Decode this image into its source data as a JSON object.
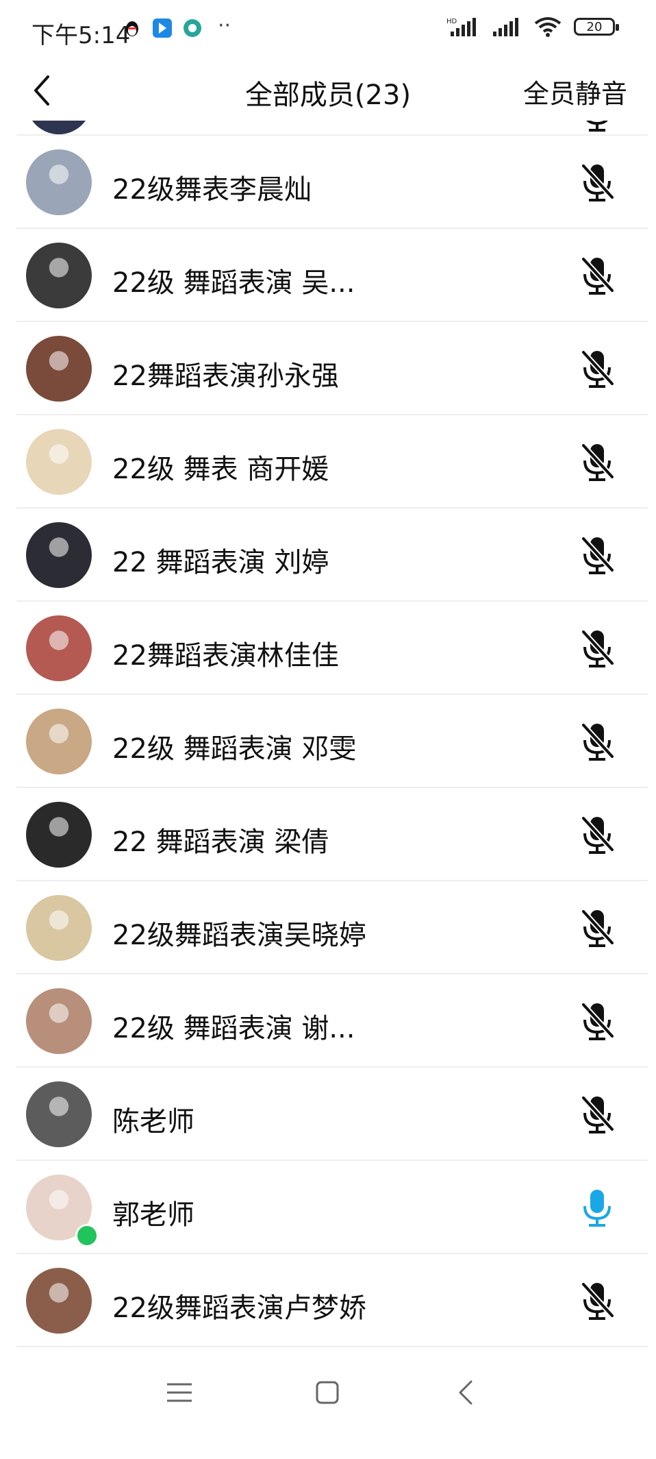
{
  "status": {
    "time": "下午5:14",
    "battery": "20",
    "dots": "··"
  },
  "header": {
    "title": "全部成员(23)",
    "mute_all": "全员静音"
  },
  "members": [
    {
      "name": "22级舞表李晨灿",
      "mic": "muted",
      "avatar_color": "#9aa6b8"
    },
    {
      "name": "22级 舞蹈表演 吴...",
      "mic": "muted",
      "avatar_color": "#3b3b3b"
    },
    {
      "name": "22舞蹈表演孙永强",
      "mic": "muted",
      "avatar_color": "#7a4a3a"
    },
    {
      "name": "22级 舞表 商开媛",
      "mic": "muted",
      "avatar_color": "#e8d6b8"
    },
    {
      "name": "22 舞蹈表演 刘婷",
      "mic": "muted",
      "avatar_color": "#2c2c34"
    },
    {
      "name": "22舞蹈表演林佳佳",
      "mic": "muted",
      "avatar_color": "#b45a52"
    },
    {
      "name": "22级 舞蹈表演 邓雯",
      "mic": "muted",
      "avatar_color": "#c9a886"
    },
    {
      "name": "22 舞蹈表演 梁倩",
      "mic": "muted",
      "avatar_color": "#2a2a2a"
    },
    {
      "name": "22级舞蹈表演吴晓婷",
      "mic": "muted",
      "avatar_color": "#d9c7a2"
    },
    {
      "name": "22级  舞蹈表演  谢...",
      "mic": "muted",
      "avatar_color": "#b78f7a"
    },
    {
      "name": "陈老师",
      "mic": "muted",
      "avatar_color": "#5c5c5c"
    },
    {
      "name": "郭老师",
      "mic": "active",
      "avatar_color": "#e7d3c9"
    },
    {
      "name": "22级舞蹈表演卢梦娇",
      "mic": "muted",
      "avatar_color": "#8b5e4b"
    }
  ],
  "colors": {
    "accent": "#1aa7e6",
    "muted_icon": "#111111",
    "speaking_badge": "#21c35b"
  }
}
